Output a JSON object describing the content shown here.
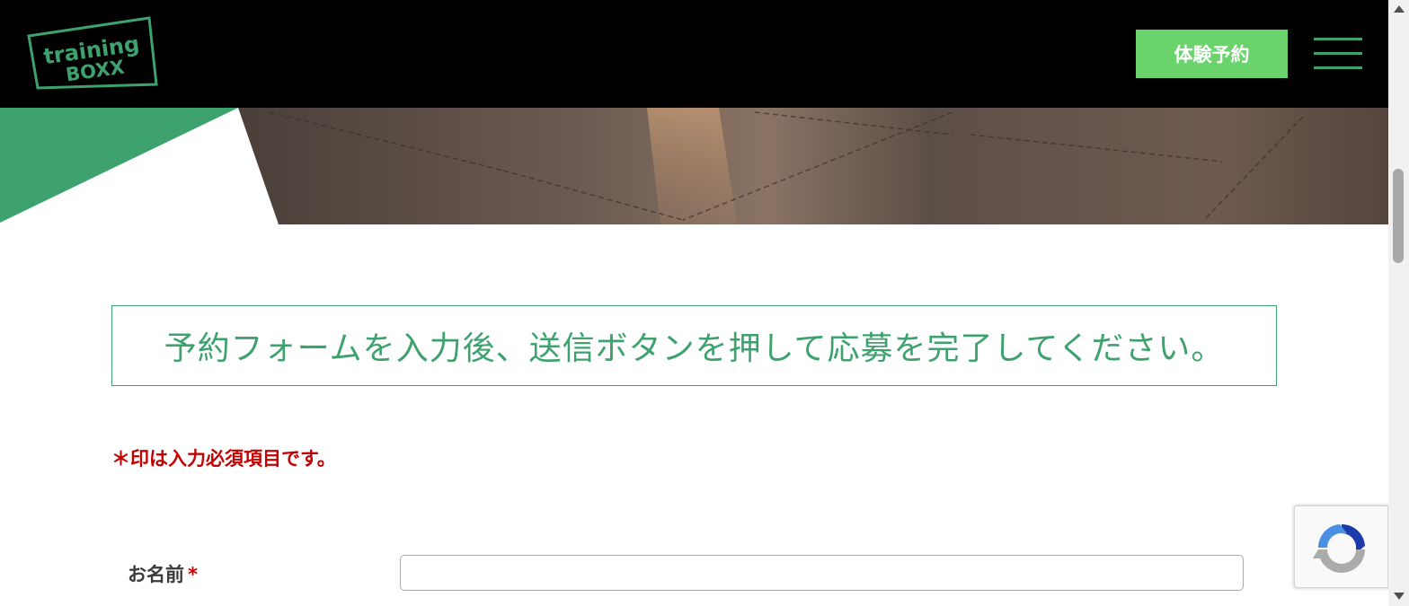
{
  "header": {
    "logo_line1": "training",
    "logo_line2": "BOXX",
    "cta_label": "体験予約",
    "menu_icon": "hamburger-menu-icon"
  },
  "form": {
    "notice": "予約フォームを入力後、送信ボタンを押して応募を完了してください。",
    "required_note": "＊印は入力必須項目です。",
    "name_label": "お名前",
    "required_mark": "*",
    "name_value": ""
  },
  "widgets": {
    "recaptcha_icon": "recaptcha-icon"
  },
  "colors": {
    "brand_green": "#3ea26f",
    "cta_green": "#6bd36c",
    "required_red": "#c40000",
    "header_bg": "#000000"
  }
}
